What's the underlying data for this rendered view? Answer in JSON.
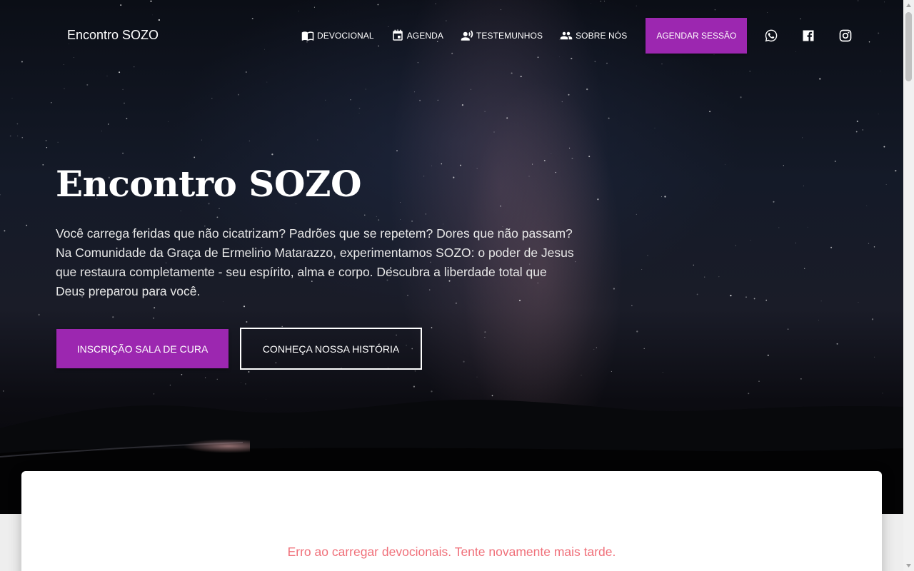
{
  "nav": {
    "brand": "Encontro SOZO",
    "items": [
      {
        "label": "DEVOCIONAL",
        "icon": "book-open-icon"
      },
      {
        "label": "AGENDA",
        "icon": "calendar-icon"
      },
      {
        "label": "TESTEMUNHOS",
        "icon": "record-voice-icon"
      },
      {
        "label": "SOBRE NÓS",
        "icon": "people-icon"
      }
    ],
    "cta_label": "AGENDAR SESSÃO",
    "social": [
      "whatsapp-icon",
      "facebook-icon",
      "instagram-icon"
    ]
  },
  "hero": {
    "title": "Encontro SOZO",
    "text": "Você carrega feridas que não cicatrizam? Padrões que se repetem? Dores que não passam? Na Comunidade da Graça de Ermelino Matarazzo, experimentamos SOZO: o poder de Jesus que restaura completamente - seu espírito, alma e corpo. Descubra a liberdade total que Deus preparou para você.",
    "primary_button": "INSCRIÇÃO SALA DE CURA",
    "secondary_button": "CONHEÇA NOSSA HISTÓRIA"
  },
  "devotionals": {
    "error": "Erro ao carregar devocionais. Tente novamente mais tarde."
  },
  "colors": {
    "accent": "#9c27b0",
    "error": "#f0707a"
  }
}
